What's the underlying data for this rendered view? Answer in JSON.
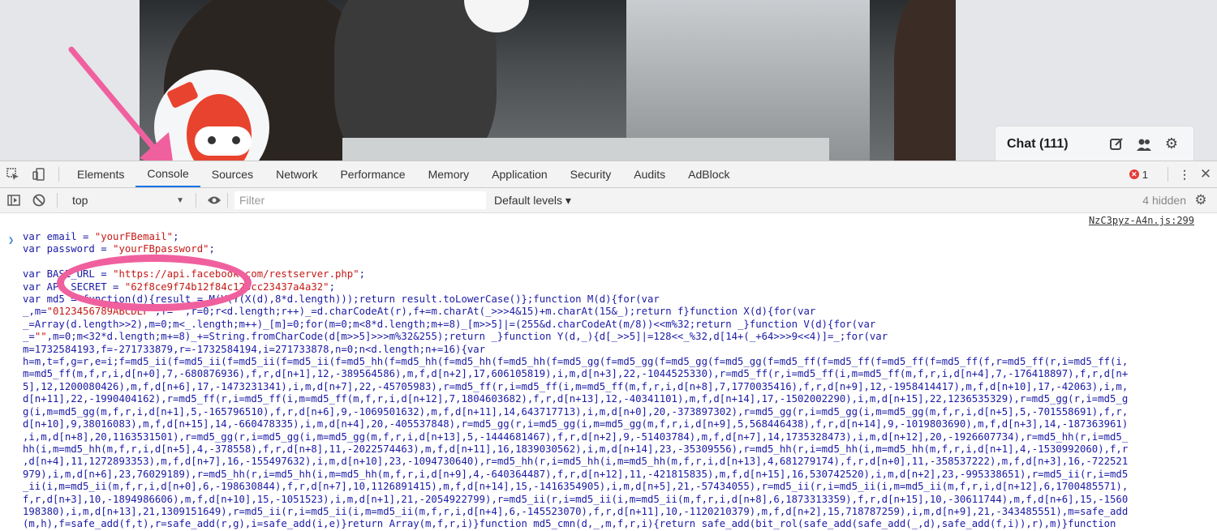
{
  "chat": {
    "title": "Chat (111)"
  },
  "devtools": {
    "tabs": [
      "Elements",
      "Console",
      "Sources",
      "Network",
      "Performance",
      "Memory",
      "Application",
      "Security",
      "Audits",
      "AdBlock"
    ],
    "error_count": "1",
    "context": "top",
    "filter_placeholder": "Filter",
    "levels": "Default levels ▾",
    "hidden": "4 hidden",
    "source_link": "NzC3pyz-A4n.js:299"
  },
  "console": {
    "lines": [
      "var email = \"yourFBemail\";",
      "var password = \"yourFBpassword\";",
      "",
      "var BASE_URL = \"https://api.facebook.com/restserver.php\";",
      "var API_SECRET = \"62f8ce9f74b12f84c123cc23437a4a32\";",
      "var md5 = function(d){result = M(V(Y(X(d),8*d.length)));return result.toLowerCase()};function M(d){for(var",
      "_,m=\"0123456789ABCDEF\",f=\"\",r=0;r<d.length;r++)_=d.charCodeAt(r),f+=m.charAt(_>>>4&15)+m.charAt(15&_);return f}function X(d){for(var",
      "_=Array(d.length>>2),m=0;m<_.length;m++)_[m]=0;for(m=0;m<8*d.length;m+=8)_[m>>5]|=(255&d.charCodeAt(m/8))<<m%32;return _}function V(d){for(var",
      "_=\"\",m=0;m<32*d.length;m+=8)_+=String.fromCharCode(d[m>>5]>>>m%32&255);return _}function Y(d,_){d[_>>5]|=128<<_%32,d[14+(_+64>>>9<<4)]=_;for(var",
      "m=1732584193,f=-271733879,r=-1732584194,i=271733878,n=0;n<d.length;n+=16){var",
      "h=m,t=f,g=r,e=i;f=md5_ii(f=md5_ii(f=md5_ii(f=md5_ii(f=md5_hh(f=md5_hh(f=md5_hh(f=md5_hh(f=md5_gg(f=md5_gg(f=md5_gg(f=md5_gg(f=md5_ff(f=md5_ff(f=md5_ff(f=md5_ff(f,r=md5_ff(r,i=md5_ff(i,",
      "m=md5_ff(m,f,r,i,d[n+0],7,-680876936),f,r,d[n+1],12,-389564586),m,f,d[n+2],17,606105819),i,m,d[n+3],22,-1044525330),r=md5_ff(r,i=md5_ff(i,m=md5_ff(m,f,r,i,d[n+4],7,-176418897),f,r,d[n+",
      "5],12,1200080426),m,f,d[n+6],17,-1473231341),i,m,d[n+7],22,-45705983),r=md5_ff(r,i=md5_ff(i,m=md5_ff(m,f,r,i,d[n+8],7,1770035416),f,r,d[n+9],12,-1958414417),m,f,d[n+10],17,-42063),i,m,",
      "d[n+11],22,-1990404162),r=md5_ff(r,i=md5_ff(i,m=md5_ff(m,f,r,i,d[n+12],7,1804603682),f,r,d[n+13],12,-40341101),m,f,d[n+14],17,-1502002290),i,m,d[n+15],22,1236535329),r=md5_gg(r,i=md5_g",
      "g(i,m=md5_gg(m,f,r,i,d[n+1],5,-165796510),f,r,d[n+6],9,-1069501632),m,f,d[n+11],14,643717713),i,m,d[n+0],20,-373897302),r=md5_gg(r,i=md5_gg(i,m=md5_gg(m,f,r,i,d[n+5],5,-701558691),f,r,",
      "d[n+10],9,38016083),m,f,d[n+15],14,-660478335),i,m,d[n+4],20,-405537848),r=md5_gg(r,i=md5_gg(i,m=md5_gg(m,f,r,i,d[n+9],5,568446438),f,r,d[n+14],9,-1019803690),m,f,d[n+3],14,-187363961)",
      ",i,m,d[n+8],20,1163531501),r=md5_gg(r,i=md5_gg(i,m=md5_gg(m,f,r,i,d[n+13],5,-1444681467),f,r,d[n+2],9,-51403784),m,f,d[n+7],14,1735328473),i,m,d[n+12],20,-1926607734),r=md5_hh(r,i=md5_",
      "hh(i,m=md5_hh(m,f,r,i,d[n+5],4,-378558),f,r,d[n+8],11,-2022574463),m,f,d[n+11],16,1839030562),i,m,d[n+14],23,-35309556),r=md5_hh(r,i=md5_hh(i,m=md5_hh(m,f,r,i,d[n+1],4,-1530992060),f,r",
      ",d[n+4],11,1272893353),m,f,d[n+7],16,-155497632),i,m,d[n+10],23,-1094730640),r=md5_hh(r,i=md5_hh(i,m=md5_hh(m,f,r,i,d[n+13],4,681279174),f,r,d[n+0],11,-358537222),m,f,d[n+3],16,-722521",
      "979),i,m,d[n+6],23,76029189),r=md5_hh(r,i=md5_hh(i,m=md5_hh(m,f,r,i,d[n+9],4,-640364487),f,r,d[n+12],11,-421815835),m,f,d[n+15],16,530742520),i,m,d[n+2],23,-995338651),r=md5_ii(r,i=md5",
      "_ii(i,m=md5_ii(m,f,r,i,d[n+0],6,-198630844),f,r,d[n+7],10,1126891415),m,f,d[n+14],15,-1416354905),i,m,d[n+5],21,-57434055),r=md5_ii(r,i=md5_ii(i,m=md5_ii(m,f,r,i,d[n+12],6,1700485571),",
      "f,r,d[n+3],10,-1894986606),m,f,d[n+10],15,-1051523),i,m,d[n+1],21,-2054922799),r=md5_ii(r,i=md5_ii(i,m=md5_ii(m,f,r,i,d[n+8],6,1873313359),f,r,d[n+15],10,-30611744),m,f,d[n+6],15,-1560",
      "198380),i,m,d[n+13],21,1309151649),r=md5_ii(r,i=md5_ii(i,m=md5_ii(m,f,r,i,d[n+4],6,-145523070),f,r,d[n+11],10,-1120210379),m,f,d[n+2],15,718787259),i,m,d[n+9],21,-343485551),m=safe_add",
      "(m,h),f=safe_add(f,t),r=safe_add(r,g),i=safe_add(i,e)}return Array(m,f,r,i)}function md5_cmn(d,_,m,f,r,i){return safe_add(bit_rol(safe_add(safe_add(_,d),safe_add(f,i)),r),m)}function"
    ]
  },
  "colors": {
    "accent": "#1a73e8",
    "highlight": "#f0609e",
    "code": "#1a1aa6",
    "string": "#c41a16"
  }
}
